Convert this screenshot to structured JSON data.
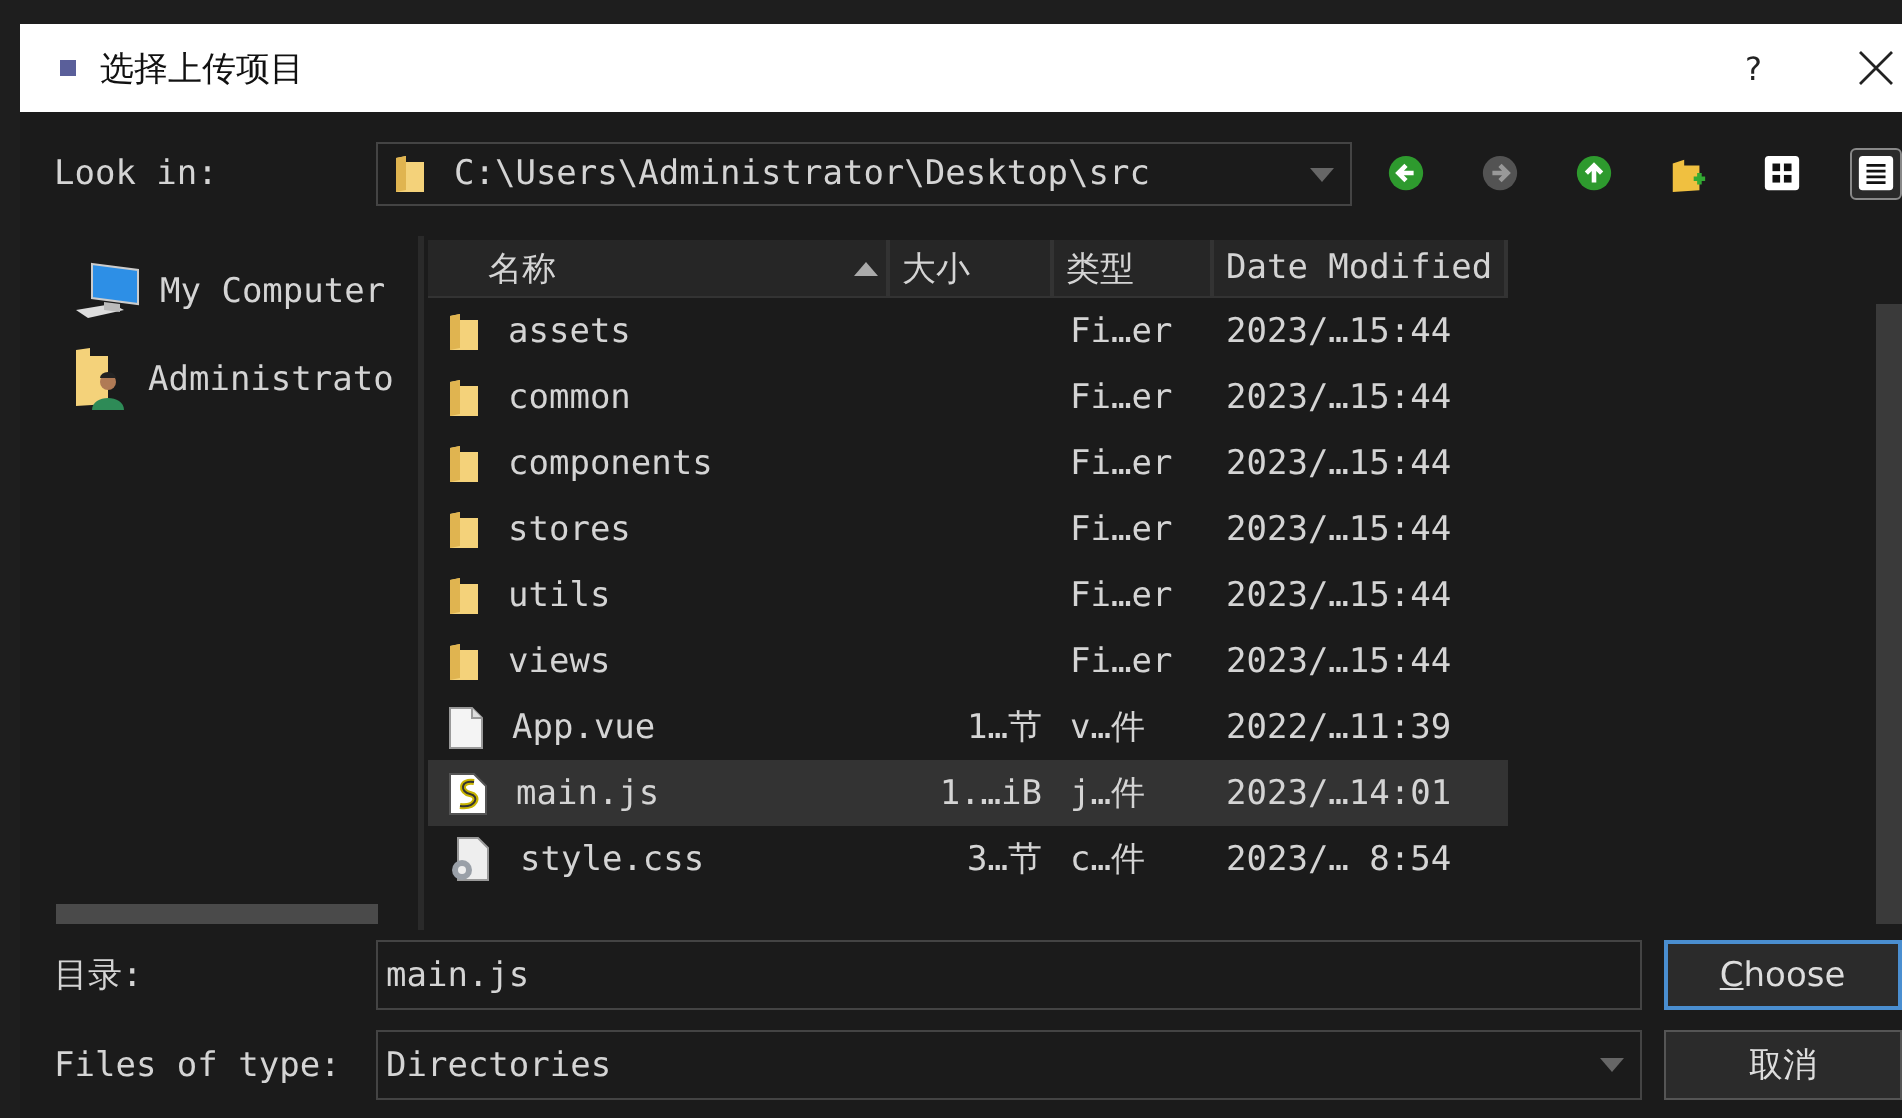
{
  "window": {
    "title": "选择上传项目",
    "help": "?"
  },
  "look_in": {
    "label": "Look in:",
    "path": "C:\\Users\\Administrator\\Desktop\\src"
  },
  "toolbar": [
    {
      "kind": "back",
      "disabled": false,
      "selected": false
    },
    {
      "kind": "forward",
      "disabled": true,
      "selected": false
    },
    {
      "kind": "up",
      "disabled": false,
      "selected": false
    },
    {
      "kind": "new-folder",
      "disabled": false,
      "selected": false
    },
    {
      "kind": "icon-view",
      "disabled": false,
      "selected": false
    },
    {
      "kind": "detail-view",
      "disabled": false,
      "selected": true
    }
  ],
  "sidebar": {
    "items": [
      {
        "label": "My Computer",
        "kind": "computer"
      },
      {
        "label": "Administrato",
        "kind": "user"
      }
    ]
  },
  "table": {
    "columns": [
      {
        "label": "名称",
        "sorted": true
      },
      {
        "label": "大小",
        "sorted": false
      },
      {
        "label": "类型",
        "sorted": false
      },
      {
        "label": "Date Modified",
        "sorted": false
      }
    ],
    "rows": [
      {
        "kind": "folder",
        "name": "assets",
        "size": "",
        "type": "Fi…er",
        "date": "2023/…15:44",
        "selected": false
      },
      {
        "kind": "folder",
        "name": "common",
        "size": "",
        "type": "Fi…er",
        "date": "2023/…15:44",
        "selected": false
      },
      {
        "kind": "folder",
        "name": "components",
        "size": "",
        "type": "Fi…er",
        "date": "2023/…15:44",
        "selected": false
      },
      {
        "kind": "folder",
        "name": "stores",
        "size": "",
        "type": "Fi…er",
        "date": "2023/…15:44",
        "selected": false
      },
      {
        "kind": "folder",
        "name": "utils",
        "size": "",
        "type": "Fi…er",
        "date": "2023/…15:44",
        "selected": false
      },
      {
        "kind": "folder",
        "name": "views",
        "size": "",
        "type": "Fi…er",
        "date": "2023/…15:44",
        "selected": false
      },
      {
        "kind": "file",
        "name": "App.vue",
        "size": "1…节",
        "type": "v…件",
        "date": "2022/…11:39",
        "selected": false
      },
      {
        "kind": "script",
        "name": "main.js",
        "size": "1.…iB",
        "type": "j…件",
        "date": "2023/…14:01",
        "selected": true
      },
      {
        "kind": "stylesheet",
        "name": "style.css",
        "size": "3…节",
        "type": "c…件",
        "date": "2023/… 8:54",
        "selected": false
      }
    ]
  },
  "file_name": {
    "label": "目录:",
    "value": "main.js"
  },
  "file_type": {
    "label": "Files of type:",
    "value": "Directories"
  },
  "buttons": [
    {
      "label": "Choose",
      "default": true
    },
    {
      "label": "取消",
      "default": false
    }
  ]
}
